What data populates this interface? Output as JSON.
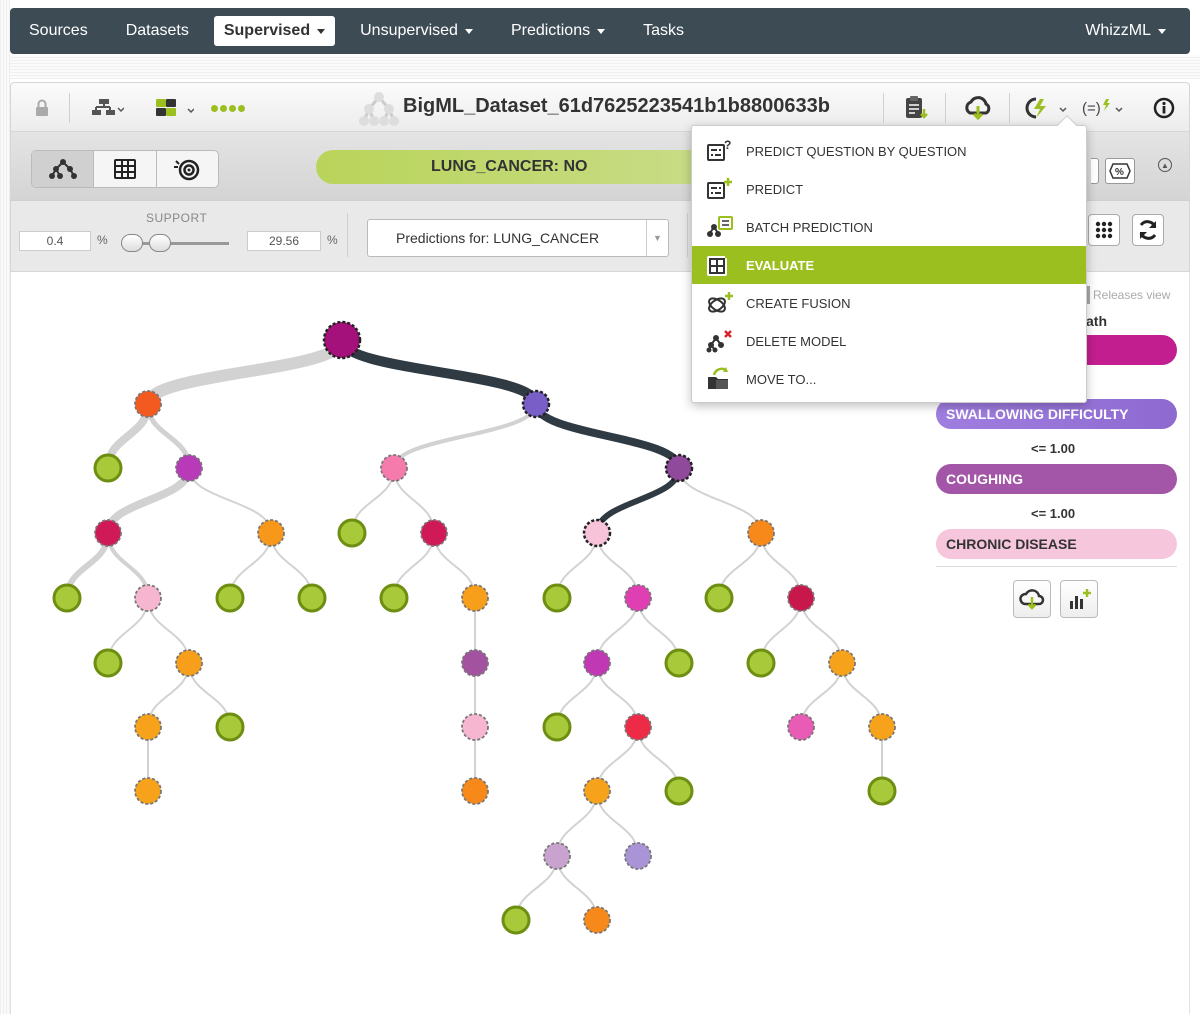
{
  "nav": {
    "items": [
      {
        "label": "Sources",
        "caret": false,
        "active": false
      },
      {
        "label": "Datasets",
        "caret": false,
        "active": false
      },
      {
        "label": "Supervised",
        "caret": true,
        "active": true
      },
      {
        "label": "Unsupervised",
        "caret": true,
        "active": false
      },
      {
        "label": "Predictions",
        "caret": true,
        "active": false
      },
      {
        "label": "Tasks",
        "caret": false,
        "active": false
      }
    ],
    "user_menu": "WhizzML"
  },
  "model": {
    "title": "BigML_Dataset_61d7625223541b1b8800633b"
  },
  "predicted": {
    "label": "LUNG_CANCER: NO"
  },
  "support": {
    "label": "SUPPORT",
    "min_value": "0.4",
    "max_value": "29.56",
    "unit": "%"
  },
  "prediction_select": {
    "value": "Predictions for: LUNG_CANCER"
  },
  "menu": {
    "items": [
      {
        "label": "PREDICT QUESTION BY QUESTION",
        "icon": "predict-question-icon",
        "active": false
      },
      {
        "label": "PREDICT",
        "icon": "predict-icon",
        "active": false
      },
      {
        "label": "BATCH PREDICTION",
        "icon": "batch-prediction-icon",
        "active": false
      },
      {
        "label": "EVALUATE",
        "icon": "evaluate-icon",
        "active": true
      },
      {
        "label": "CREATE FUSION",
        "icon": "fusion-icon",
        "active": false
      },
      {
        "label": "DELETE MODEL",
        "icon": "delete-model-icon",
        "active": false
      },
      {
        "label": "MOVE TO...",
        "icon": "move-to-icon",
        "active": false
      }
    ]
  },
  "right_panel": {
    "releases_view": "Releases view",
    "path_label": "ath",
    "path_nodes": [
      {
        "label": "",
        "color": "#c21e8f"
      },
      {
        "label": "SWALLOWING DIFFICULTY",
        "color": "#8e6ad0"
      },
      {
        "label": "COUGHING",
        "color": "#a355a7"
      },
      {
        "label": "CHRONIC DISEASE",
        "color": "#f6c6dd"
      }
    ],
    "conditions": [
      "<= 1.00",
      "<= 1.00"
    ]
  },
  "colors": {
    "nav_bg": "#3d4b55",
    "accent_green": "#9bbf1f",
    "path_dark": "#2f3a43"
  }
}
